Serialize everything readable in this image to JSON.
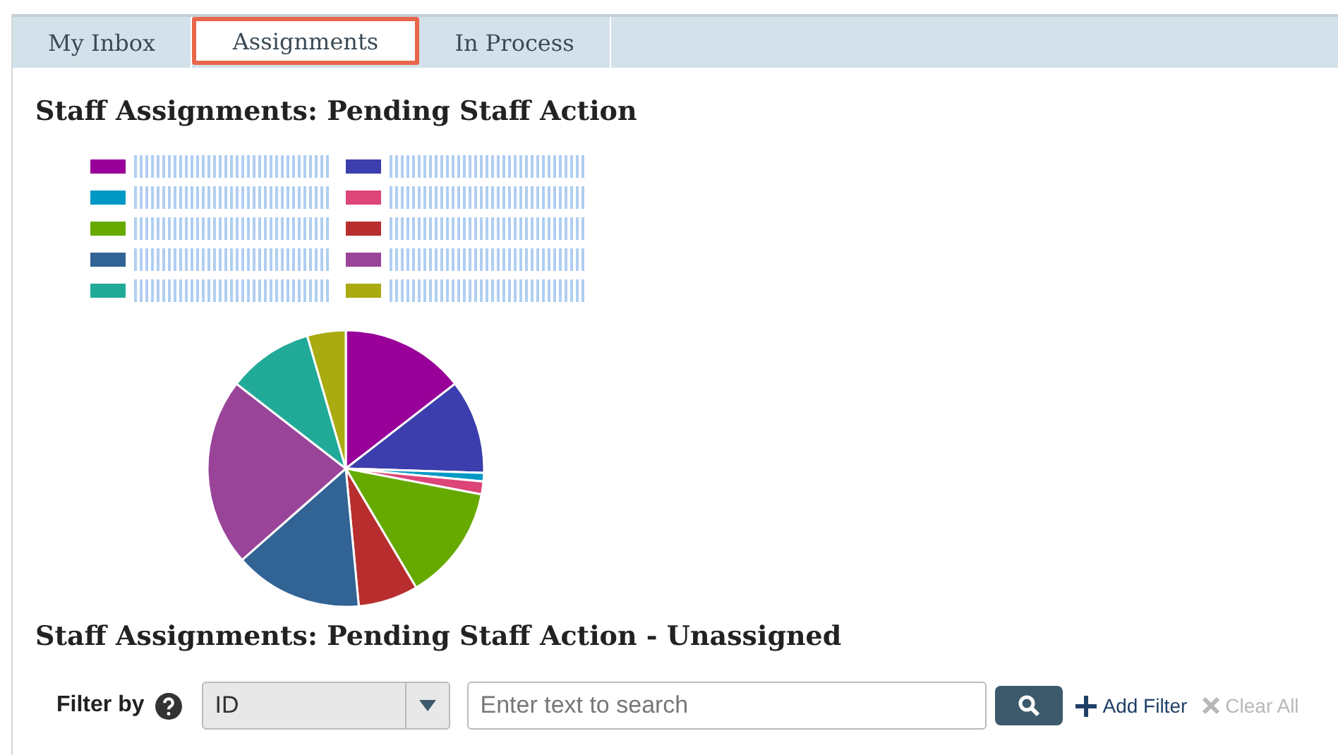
{
  "tabs": [
    {
      "label": "My Inbox",
      "selected": false
    },
    {
      "label": "Assignments",
      "selected": true
    },
    {
      "label": "In Process",
      "selected": false
    }
  ],
  "chart_section": {
    "title": "Staff Assignments: Pending Staff Action",
    "legend": [
      {
        "color": "#990099"
      },
      {
        "color": "#3b3eac"
      },
      {
        "color": "#0099c6"
      },
      {
        "color": "#dd4477"
      },
      {
        "color": "#66aa00"
      },
      {
        "color": "#b82e2e"
      },
      {
        "color": "#316395"
      },
      {
        "color": "#994499"
      },
      {
        "color": "#22aa99"
      },
      {
        "color": "#aaaa11"
      }
    ]
  },
  "unassigned_section": {
    "title": "Staff Assignments: Pending Staff Action - Unassigned",
    "filter": {
      "label": "Filter by",
      "field": "ID",
      "placeholder": "Enter text to search",
      "add_filter": "Add Filter",
      "clear_all": {
        "label": "Clear All",
        "disabled": true
      }
    }
  }
}
